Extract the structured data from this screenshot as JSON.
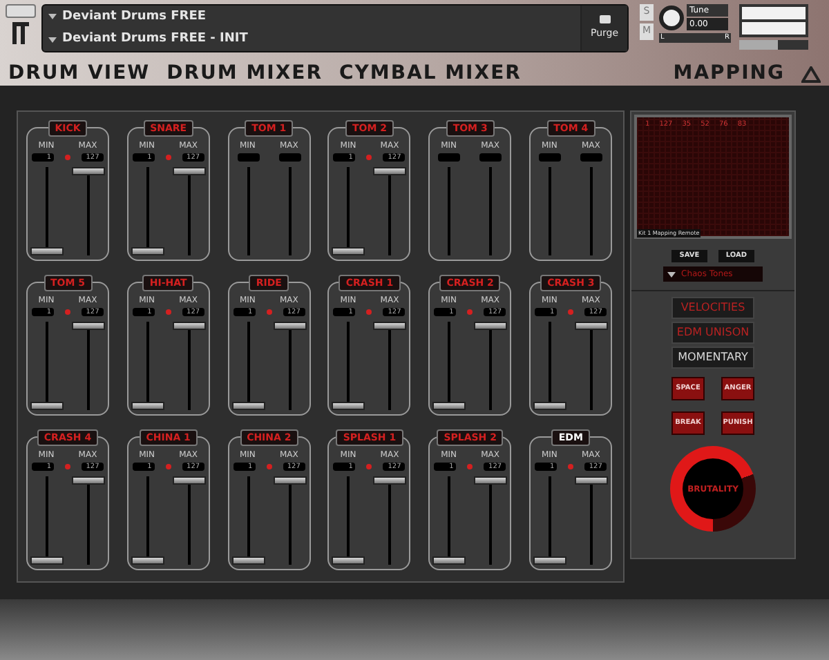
{
  "header": {
    "instrument": "Deviant Drums FREE",
    "preset": "Deviant Drums FREE - INIT",
    "purge": "Purge",
    "solo": "S",
    "mute": "M",
    "tune_label": "Tune",
    "tune_value": "0.00",
    "pan_left": "L",
    "pan_right": "R",
    "volume": {
      "level": 0.55
    }
  },
  "tabs": [
    {
      "label": "DRUM VIEW",
      "selected": false
    },
    {
      "label": "DRUM MIXER",
      "selected": false
    },
    {
      "label": "CYMBAL MIXER",
      "selected": false
    },
    {
      "label": "MAPPING",
      "selected": false
    }
  ],
  "channels": [
    {
      "name": "KICK",
      "enabled": true,
      "highlighted": false,
      "min_label": "MIN",
      "max_label": "MAX",
      "min": "1",
      "max": "127"
    },
    {
      "name": "SNARE",
      "enabled": true,
      "highlighted": false,
      "min_label": "MIN",
      "max_label": "MAX",
      "min": "1",
      "max": "127"
    },
    {
      "name": "TOM 1",
      "enabled": false,
      "highlighted": false,
      "min_label": "MIN",
      "max_label": "MAX"
    },
    {
      "name": "TOM 2",
      "enabled": true,
      "highlighted": false,
      "min_label": "MIN",
      "max_label": "MAX",
      "min": "1",
      "max": "127"
    },
    {
      "name": "TOM 3",
      "enabled": false,
      "highlighted": false,
      "min_label": "MIN",
      "max_label": "MAX"
    },
    {
      "name": "TOM 4",
      "enabled": false,
      "highlighted": false,
      "min_label": "MIN",
      "max_label": "MAX"
    },
    {
      "name": "TOM 5",
      "enabled": true,
      "highlighted": false,
      "min_label": "MIN",
      "max_label": "MAX",
      "min": "1",
      "max": "127"
    },
    {
      "name": "HI-HAT",
      "enabled": true,
      "highlighted": false,
      "min_label": "MIN",
      "max_label": "MAX",
      "min": "1",
      "max": "127"
    },
    {
      "name": "RIDE",
      "enabled": true,
      "highlighted": false,
      "min_label": "MIN",
      "max_label": "MAX",
      "min": "1",
      "max": "127"
    },
    {
      "name": "CRASH 1",
      "enabled": true,
      "highlighted": false,
      "min_label": "MIN",
      "max_label": "MAX",
      "min": "1",
      "max": "127"
    },
    {
      "name": "CRASH 2",
      "enabled": true,
      "highlighted": false,
      "min_label": "MIN",
      "max_label": "MAX",
      "min": "1",
      "max": "127"
    },
    {
      "name": "CRASH 3",
      "enabled": true,
      "highlighted": false,
      "min_label": "MIN",
      "max_label": "MAX",
      "min": "1",
      "max": "127"
    },
    {
      "name": "CRASH 4",
      "enabled": true,
      "highlighted": false,
      "min_label": "MIN",
      "max_label": "MAX",
      "min": "1",
      "max": "127"
    },
    {
      "name": "CHINA 1",
      "enabled": true,
      "highlighted": false,
      "min_label": "MIN",
      "max_label": "MAX",
      "min": "1",
      "max": "127"
    },
    {
      "name": "CHINA 2",
      "enabled": true,
      "highlighted": false,
      "min_label": "MIN",
      "max_label": "MAX",
      "min": "1",
      "max": "127"
    },
    {
      "name": "SPLASH 1",
      "enabled": true,
      "highlighted": false,
      "min_label": "MIN",
      "max_label": "MAX",
      "min": "1",
      "max": "127"
    },
    {
      "name": "SPLASH 2",
      "enabled": true,
      "highlighted": false,
      "min_label": "MIN",
      "max_label": "MAX",
      "min": "1",
      "max": "127"
    },
    {
      "name": "EDM",
      "enabled": true,
      "highlighted": true,
      "min_label": "MIN",
      "max_label": "MAX",
      "min": "1",
      "max": "127"
    }
  ],
  "mapping": {
    "numbers": [
      "1",
      "127",
      "35",
      "52",
      "76",
      "83"
    ],
    "caption": "Kit 1 Mapping Remote",
    "save": "SAVE",
    "load": "LOAD",
    "kit": "Chaos Tones"
  },
  "modes": [
    {
      "label": "VELOCITIES",
      "on": true
    },
    {
      "label": "EDM UNISON",
      "on": true
    },
    {
      "label": "MOMENTARY",
      "on": false
    }
  ],
  "effects": [
    {
      "label": "SPACE"
    },
    {
      "label": "ANGER"
    },
    {
      "label": "BREAK"
    },
    {
      "label": "PUNISH"
    }
  ],
  "knob": {
    "label": "BRUTALITY"
  }
}
